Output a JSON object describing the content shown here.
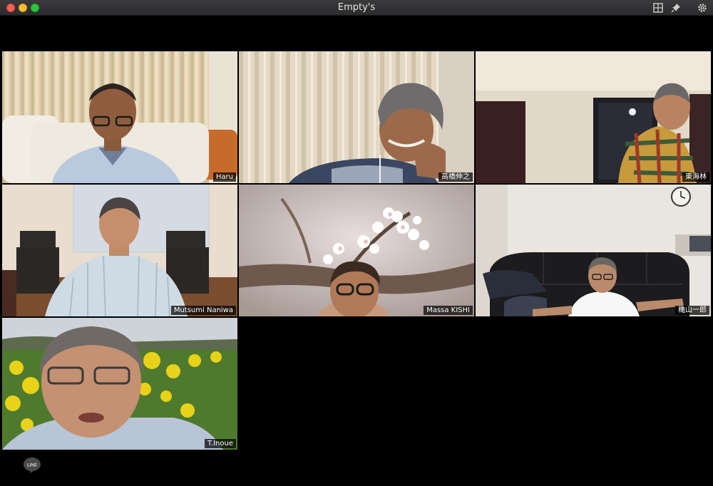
{
  "window": {
    "title": "Empty's",
    "controls": [
      "close",
      "minimize",
      "maximize"
    ],
    "toolbar_icons": [
      "layout-icon",
      "pin-icon",
      "gear-icon"
    ]
  },
  "participants": [
    {
      "name": "Haru"
    },
    {
      "name": "高橋伸之"
    },
    {
      "name": "東海林"
    },
    {
      "name": "Mutsumi Naniwa"
    },
    {
      "name": "Massa KISHI"
    },
    {
      "name": "穐山一郎"
    },
    {
      "name": "T.Inoue"
    }
  ],
  "footer": {
    "logo_text": "LINE"
  }
}
